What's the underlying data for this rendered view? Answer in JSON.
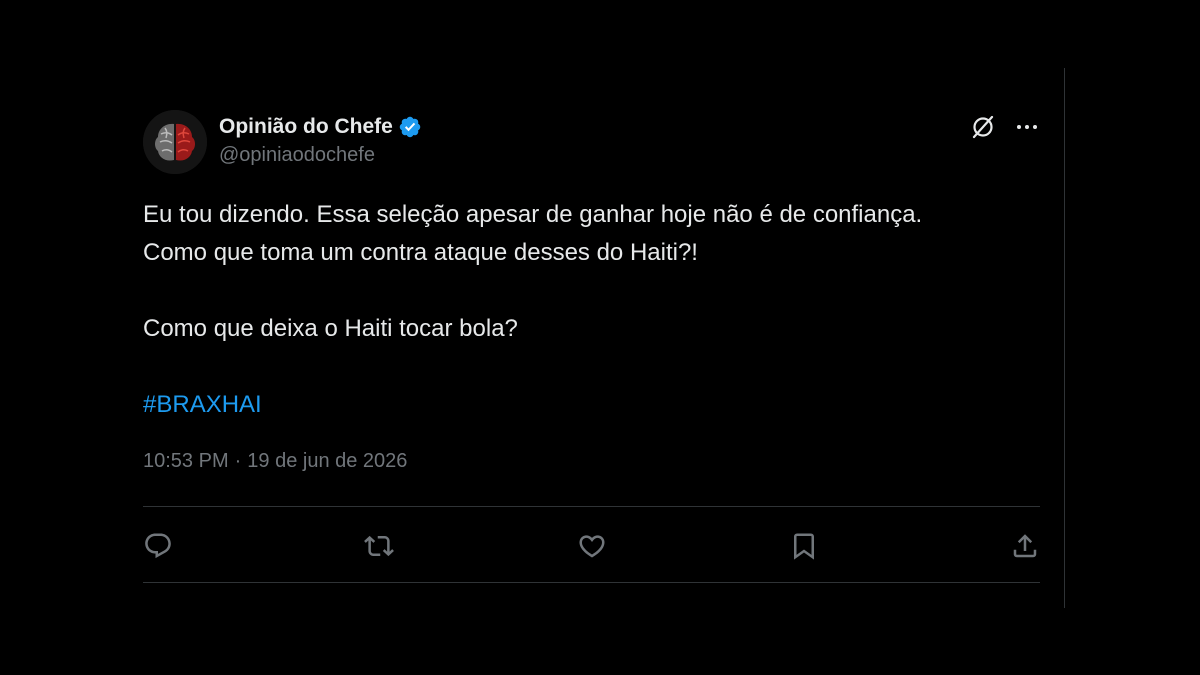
{
  "tweet": {
    "display_name": "Opinião do Chefe",
    "handle": "@opiniaodochefe",
    "verified": true,
    "body_lines": [
      "Eu tou dizendo. Essa seleção apesar de ganhar hoje não é de confiança.",
      "Como que toma um contra ataque desses do Haiti?!",
      "Como que deixa o Haiti tocar bola?"
    ],
    "hashtag": "#BRAXHAI",
    "time": "10:53 PM",
    "separator": "·",
    "date": "19 de jun de 2026"
  },
  "header_icons": [
    "grok-icon",
    "more-icon"
  ],
  "action_icons": [
    "reply-icon",
    "retweet-icon",
    "like-icon",
    "bookmark-icon",
    "share-icon"
  ],
  "colors": {
    "background": "#000000",
    "text_primary": "#e7e9ea",
    "text_secondary": "#71767b",
    "accent": "#1d9bf0",
    "border": "#2f3336"
  }
}
